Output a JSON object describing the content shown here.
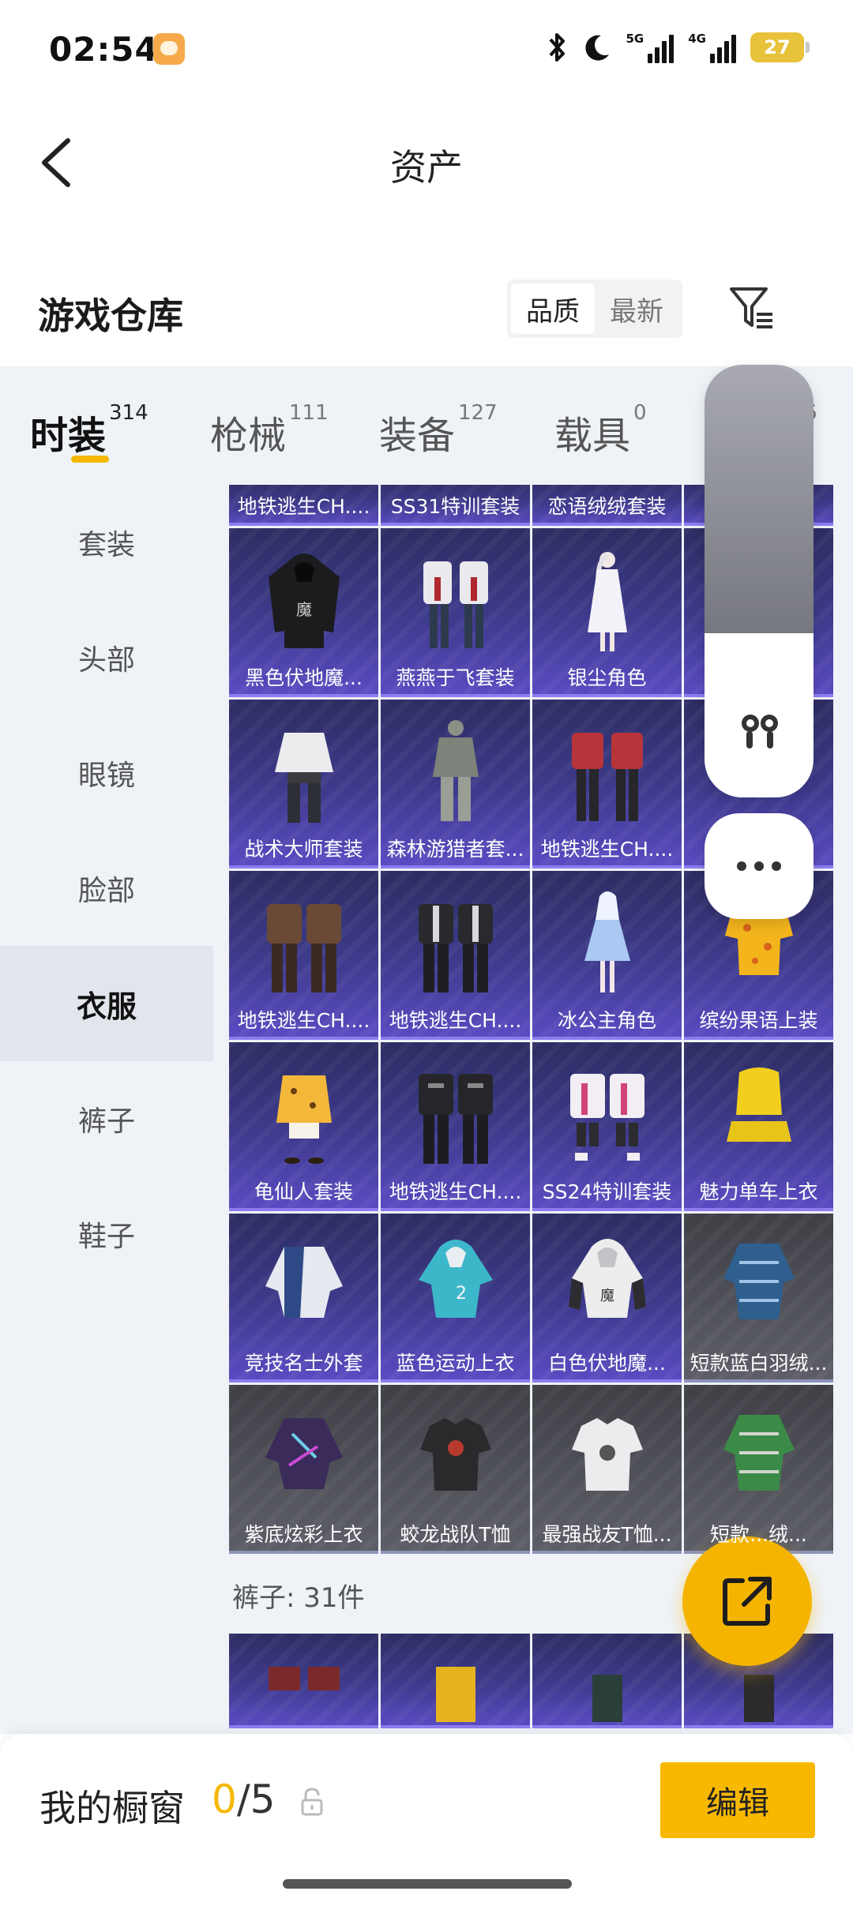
{
  "status_bar": {
    "time": "02:54",
    "icons": [
      "app-notification-icon",
      "bluetooth-icon",
      "moon-icon",
      "signal-5g-icon",
      "signal-4g-icon"
    ],
    "net1": "5G",
    "net2": "4G",
    "battery": "27"
  },
  "header": {
    "title": "资产"
  },
  "warehouse": {
    "title": "游戏仓库",
    "sort_quality": "品质",
    "sort_newest": "最新"
  },
  "category_tabs": [
    {
      "label": "时装",
      "count": "314"
    },
    {
      "label": "枪械",
      "count": "111"
    },
    {
      "label": "装备",
      "count": "127"
    },
    {
      "label": "载具",
      "count": "0"
    },
    {
      "label": "",
      "count": "6"
    }
  ],
  "sidebar": {
    "items": [
      "套装",
      "头部",
      "眼镜",
      "脸部",
      "衣服",
      "裤子",
      "鞋子"
    ],
    "active": "衣服"
  },
  "grid": {
    "top_row": [
      "地铁逃生CH....",
      "SS31特训套装",
      "恋语绒绒套装",
      ""
    ],
    "rows": [
      [
        "黑色伏地魔...",
        "燕燕于飞套装",
        "银尘角色",
        ""
      ],
      [
        "战术大师套装",
        "森林游猎者套...",
        "地铁逃生CH....",
        ""
      ],
      [
        "地铁逃生CH....",
        "地铁逃生CH....",
        "冰公主角色",
        "缤纷果语上装"
      ],
      [
        "龟仙人套装",
        "地铁逃生CH....",
        "SS24特训套装",
        "魅力单车上衣"
      ],
      [
        "竞技名士外套",
        "蓝色运动上衣",
        "白色伏地魔...",
        "短款蓝白羽绒..."
      ],
      [
        "紫底炫彩上衣",
        "蛟龙战队T恤",
        "最强战友T恤...",
        "短款...绒..."
      ]
    ],
    "pants_section": "裤子: 31件"
  },
  "bottom_bar": {
    "showcase_label": "我的橱窗",
    "showcase_current": "0",
    "showcase_total": "/5",
    "edit_label": "编辑"
  },
  "colors": {
    "accent": "#f5b800",
    "card_purple": "#3f3b8e",
    "card_gray": "#52535b",
    "panel_bg": "#eff3f8"
  }
}
